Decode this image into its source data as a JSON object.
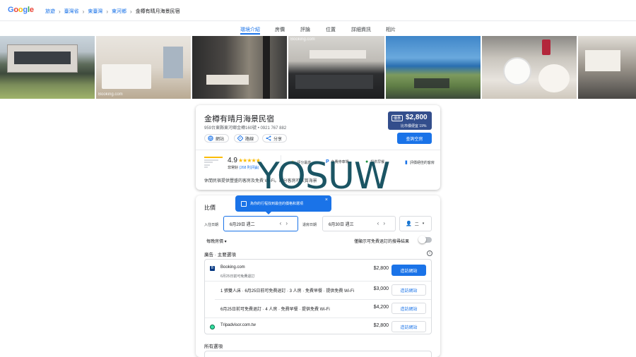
{
  "header": {
    "logo": "Google",
    "breadcrumbs": [
      "旅遊",
      "臺灣省",
      "東臺灣",
      "東河鄉",
      "金樽有晴月海景民宿"
    ]
  },
  "tabs": [
    "環境介紹",
    "房價",
    "評論",
    "位置",
    "詳細資訊",
    "相片"
  ],
  "photos": {
    "watermark_2": "Booking.com",
    "watermark_4": "Booking.com"
  },
  "hotel": {
    "name": "金樽有晴月海景民宿",
    "address": "959台東縣東河鄉金樽160號 • 0921 767 882",
    "chips": [
      "網站",
      "路線",
      "分享"
    ],
    "price_badge": "優惠",
    "price": "$2,800",
    "price_sub": "比市價便宜 19%",
    "check_button": "查詢空房",
    "rating": "4.9",
    "stars": "★★★★★",
    "rating_label": "非常好",
    "review_count": "(268 則評論)",
    "amenities": [
      "評分最高",
      "免費停車場",
      "提供早餐",
      "評價絕佳的客房"
    ],
    "description": "休閒民宿提供豐盛的客房及免費 Wi-Fi。部分客房可欣賞海景"
  },
  "watermark": "YOSUW",
  "prices": {
    "title": "比價",
    "tooltip": "為你的行程找到最佳的價格和選項",
    "checkin_label": "入住日期",
    "checkin_value": "6月29日 週二",
    "checkout_label": "退房日期",
    "checkout_value": "6月30日 週三",
    "guests_value": "二",
    "nightly": "每晚房價 ▾",
    "free_cancel": "僅顯示可免費退訂的搜尋結果",
    "featured": "廣告 · 主要選項",
    "offers": [
      {
        "name": "Booking.com",
        "sub": "6月25日前可免費退訂",
        "price": "$2,800",
        "button": "造訪網站"
      },
      {
        "name": "1 張雙人床 · 6月25日前可免費退訂 · 3 人房 · 免費早餐 · 提供免費 Wi-Fi",
        "price": "$3,000",
        "button": "造訪網站"
      },
      {
        "name": "6月25日前可免費退訂 · 4 人房 · 免費早餐 · 提供免費 Wi-Fi",
        "price": "$4,200",
        "button": "造訪網站"
      },
      {
        "name": "Tripadvisor.com.tw",
        "price": "$2,800",
        "button": "造訪網站"
      }
    ],
    "all_options": "所有選項"
  },
  "colors": {
    "accent": "#1a73e8",
    "price_box": "#334e8c",
    "star": "#fbbc04"
  }
}
